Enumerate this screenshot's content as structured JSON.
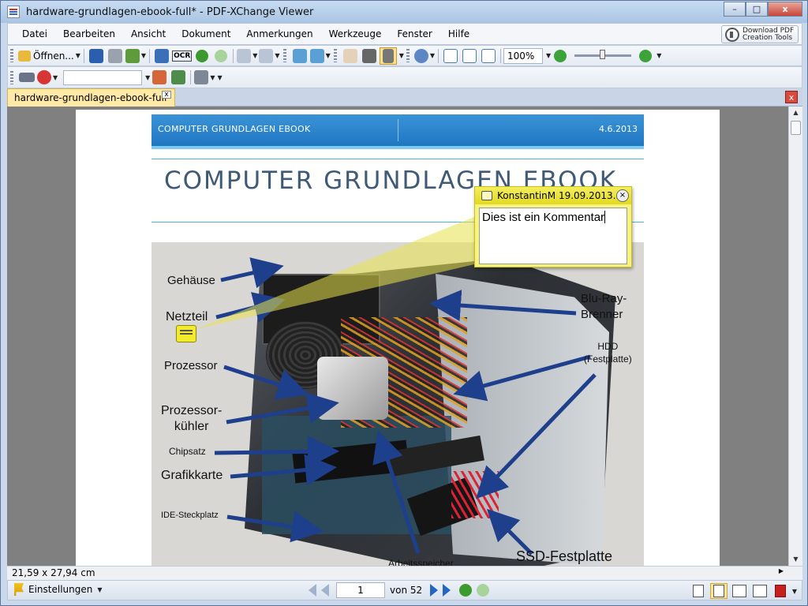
{
  "window": {
    "title": "hardware-grundlagen-ebook-full* - PDF-XChange Viewer",
    "minimize": "–",
    "maximize": "□",
    "close": "x"
  },
  "menu": {
    "items": [
      "Datei",
      "Bearbeiten",
      "Ansicht",
      "Dokument",
      "Anmerkungen",
      "Werkzeuge",
      "Fenster",
      "Hilfe"
    ],
    "download_line1": "Download PDF",
    "download_line2": "Creation Tools"
  },
  "toolbar": {
    "open_label": "Öffnen...",
    "ocr_label": "OCR",
    "zoom_value": "100%"
  },
  "tabs": {
    "active_tab": "hardware-grundlagen-ebook-full*",
    "tab_close": "x",
    "panel_close": "x"
  },
  "page": {
    "header_left": "COMPUTER GRUNDLAGEN EBOOK",
    "header_right": "4.6.2013",
    "title": "COMPUTER GRUNDLAGEN EBOOK",
    "labels": {
      "gehaeuse": "Gehäuse",
      "netzteil": "Netzteil",
      "prozessor": "Prozessor",
      "prozessorkuehler_1": "Prozessor-",
      "prozessorkuehler_2": "kühler",
      "chipsatz": "Chipsatz",
      "grafikkarte": "Grafikkarte",
      "ide": "IDE-Steckplatz",
      "arbeitsspeicher": "Arbeitsspeicher",
      "bluray_1": "Blu-Ray-",
      "bluray_2": "Brenner",
      "hdd_1": "HDD",
      "hdd_2": "(Festplatte)",
      "ssd": "SSD-Festplatte"
    }
  },
  "comment": {
    "author_date": "KonstantinM 19.09.2013...",
    "text": "Dies ist ein Kommentar",
    "close": "×",
    "color": "#f7f37b"
  },
  "status": {
    "page_size": "21,59 x 27,94 cm",
    "settings_label": "Einstellungen",
    "current_page": "1",
    "of_pages": "von 52"
  },
  "colors": {
    "header_blue": "#2a86cf",
    "title_color": "#3e5a77",
    "arrow_blue": "#1d3f8c"
  }
}
